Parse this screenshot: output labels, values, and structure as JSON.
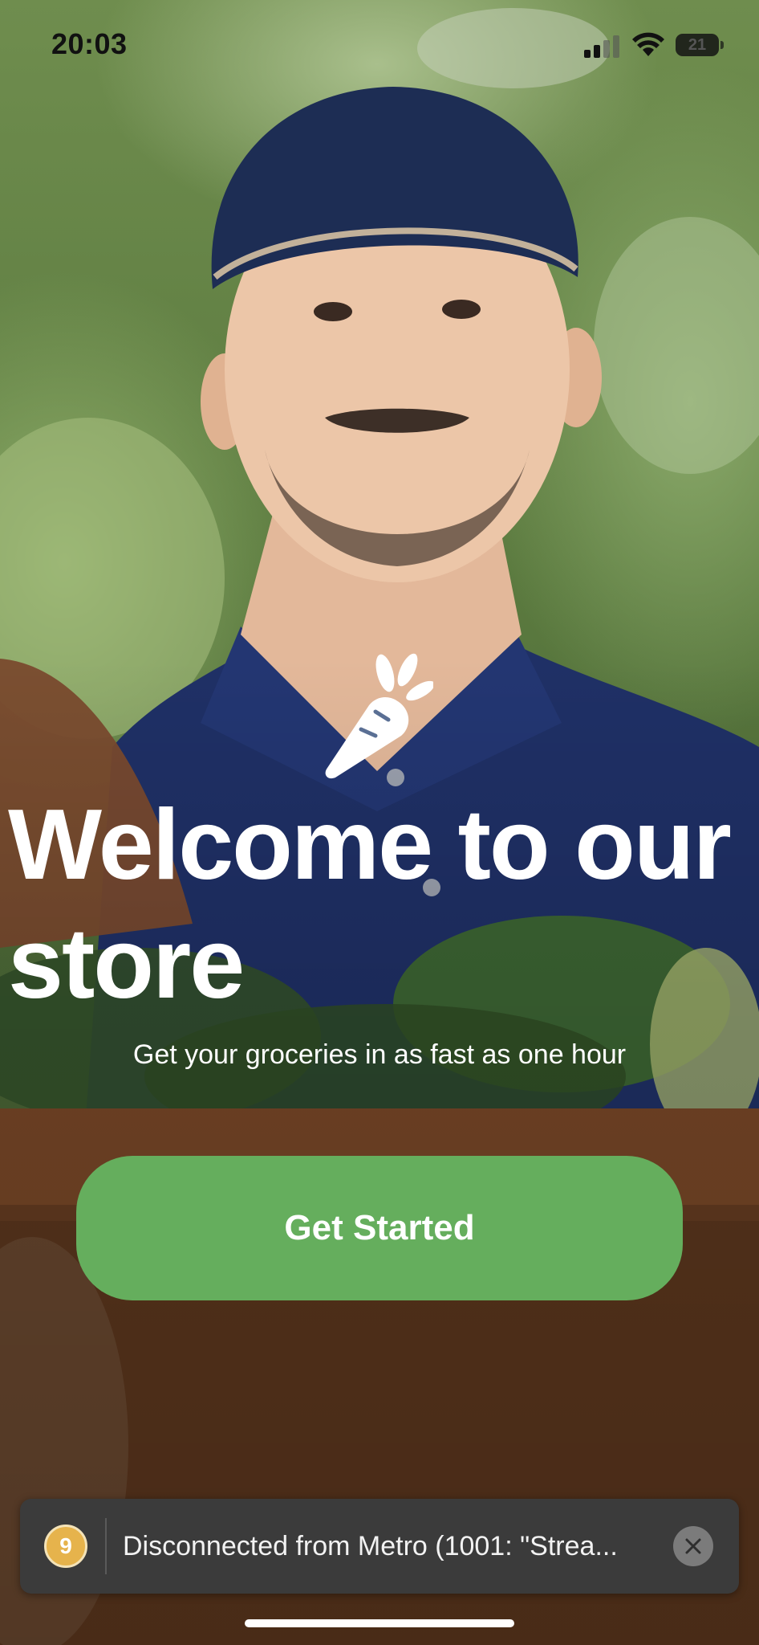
{
  "status_bar": {
    "time": "20:03",
    "battery_level": "21"
  },
  "icons": {
    "logo": "carrot-icon",
    "signal": "cellular-signal-icon",
    "wifi": "wifi-icon",
    "battery": "battery-icon",
    "close": "close-icon"
  },
  "hero": {
    "title": "Welcome to our store",
    "subtitle": "Get your groceries in as fast as one hour",
    "cta_label": "Get Started"
  },
  "toast": {
    "badge_count": "9",
    "message": "Disconnected from Metro (1001: \"Strea..."
  },
  "colors": {
    "accent": "#65ae5d",
    "badge": "#e6b34c",
    "toast_bg": "#3b3b3b"
  }
}
